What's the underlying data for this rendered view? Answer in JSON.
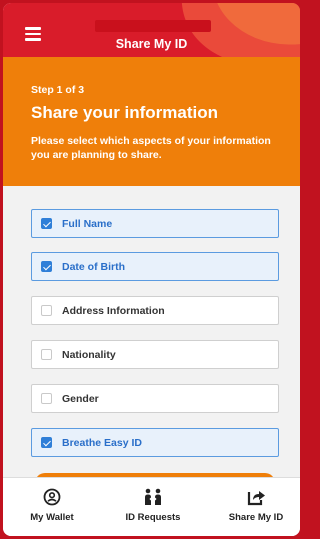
{
  "header": {
    "title": "Share My ID",
    "menu_icon": "hamburger-icon"
  },
  "hero": {
    "step": "Step 1 of 3",
    "title": "Share your information",
    "description": "Please select which aspects of your information you are planning to share."
  },
  "options": [
    {
      "label": "Full Name",
      "checked": true
    },
    {
      "label": "Date of Birth",
      "checked": true
    },
    {
      "label": "Address Information",
      "checked": false
    },
    {
      "label": "Nationality",
      "checked": false
    },
    {
      "label": "Gender",
      "checked": false
    },
    {
      "label": "Breathe Easy ID",
      "checked": true
    }
  ],
  "nav": {
    "items": [
      {
        "label": "My Wallet",
        "icon": "wallet-user-icon"
      },
      {
        "label": "ID Requests",
        "icon": "id-requests-icon"
      },
      {
        "label": "Share My ID",
        "icon": "share-icon"
      }
    ]
  },
  "colors": {
    "brand_red": "#d91c2a",
    "brand_orange": "#ef7f0a",
    "check_blue": "#2f7fd8"
  }
}
